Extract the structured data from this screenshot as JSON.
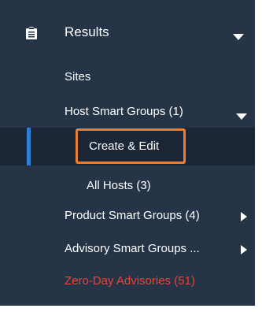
{
  "header": {
    "label": "Results",
    "icon": "clipboard-icon"
  },
  "items": [
    {
      "label": "Sites"
    },
    {
      "label": "Host Smart Groups (1)"
    },
    {
      "label": "Create & Edit"
    },
    {
      "label": "All Hosts (3)"
    },
    {
      "label": "Product Smart Groups (4)"
    },
    {
      "label": "Advisory Smart Groups ..."
    },
    {
      "label": "Zero-Day Advisories (51)"
    }
  ],
  "colors": {
    "sidebar_bg": "#263447",
    "active_bg": "#1b2737",
    "active_indicator": "#2e7fd6",
    "highlight_border": "#ee7f2f",
    "alert_text": "#f04132"
  }
}
